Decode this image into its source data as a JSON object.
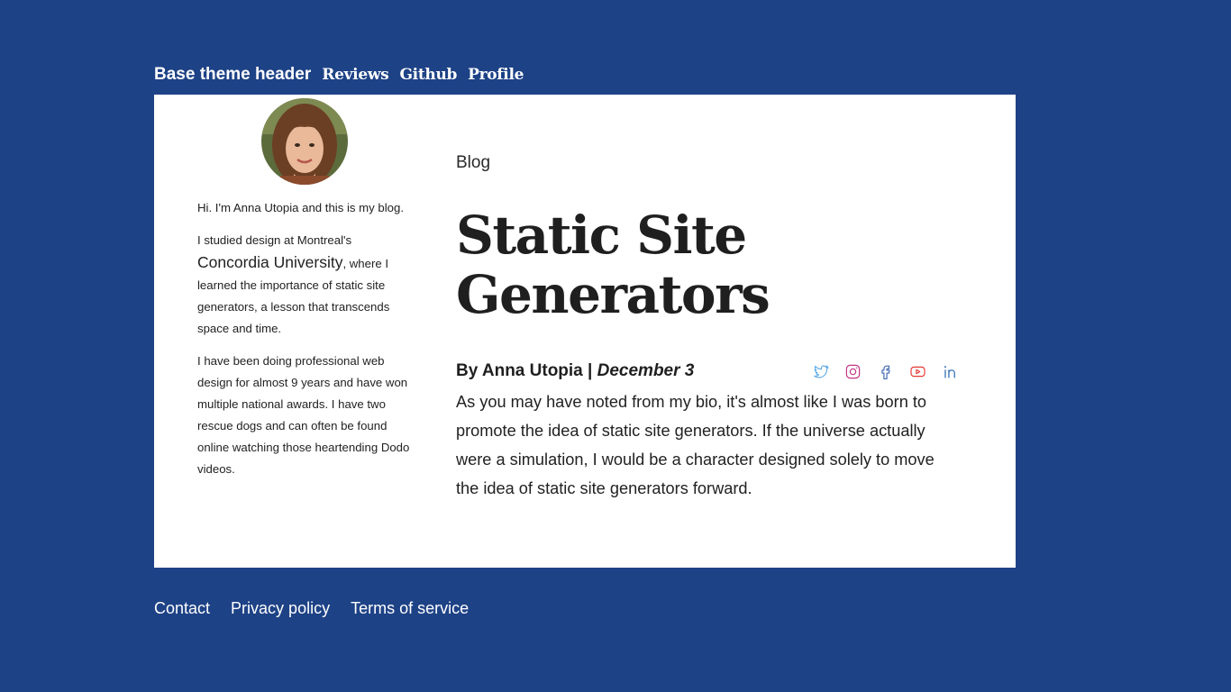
{
  "header": {
    "site_title": "Base theme header",
    "nav": [
      "Reviews",
      "Github",
      "Profile"
    ]
  },
  "sidebar": {
    "bio_p1": "Hi. I'm Anna Utopia and this is my blog.",
    "bio_p2_start": "I studied design at Montreal's",
    "bio_p2_link": "Concordia University",
    "bio_p2_end": ", where I learned the importance of static site generators, a lesson that transcends space and time.",
    "bio_p3": "I have been doing professional web design for almost 9 years and have won multiple national awards. I have two rescue dogs and can often be found online watching those heartending Dodo videos."
  },
  "post": {
    "breadcrumb": "Blog",
    "title": "Static Site Generators",
    "byline_prefix": "By Anna Utopia | ",
    "date": "December 3",
    "body": "As you may have noted from my bio, it's almost like I was born to promote the idea of static site generators. If the universe actually were a simulation, I would be a character designed solely to move the idea of static site generators forward."
  },
  "social": [
    {
      "icon": "twitter-icon",
      "color": "#5aa9e6"
    },
    {
      "icon": "instagram-icon",
      "color": "#c13584"
    },
    {
      "icon": "facebook-icon",
      "color": "#4267b2"
    },
    {
      "icon": "youtube-icon",
      "color": "#e53935"
    },
    {
      "icon": "linkedin-icon",
      "color": "#2b6cb0"
    }
  ],
  "footer": {
    "links": [
      "Contact",
      "Privacy policy",
      "Terms of service"
    ]
  },
  "colors": {
    "background": "#1e4286",
    "card": "#ffffff",
    "text": "#1f1f1f"
  }
}
